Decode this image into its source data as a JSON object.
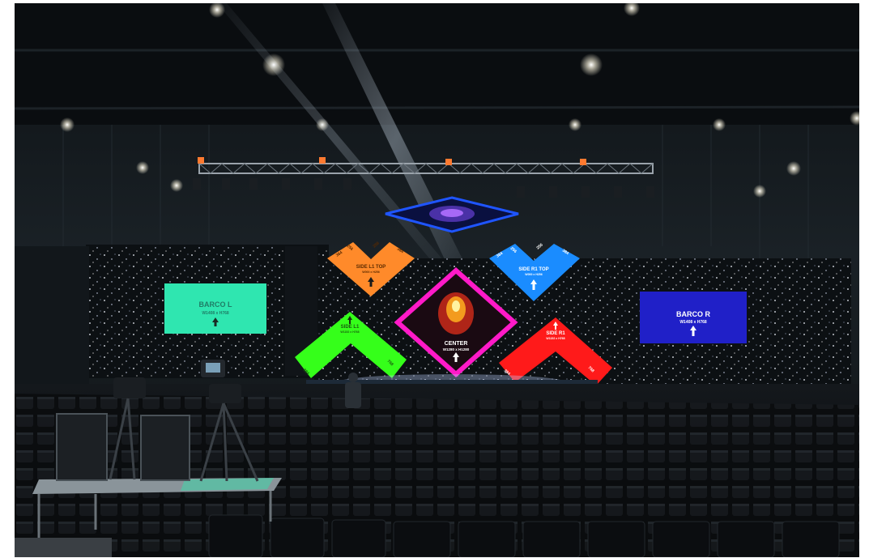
{
  "screens": {
    "barco_left": {
      "title": "BARCO L",
      "size": "W1408 x H768",
      "color": "#2fe6b0"
    },
    "barco_right": {
      "title": "BARCO R",
      "size": "W1408 x H768",
      "color": "#2020c8"
    },
    "side_l1_top": {
      "title": "SIDE L1 TOP",
      "size": "W000 x H256",
      "color": "#ff8a2a",
      "px_a": "384",
      "px_b": "256",
      "px_c": "256",
      "px_d": "384"
    },
    "side_r1_top": {
      "title": "SIDE R1 TOP",
      "size": "W000 x H256",
      "color": "#1a8cff",
      "px_a": "384",
      "px_b": "256",
      "px_c": "256",
      "px_d": "384"
    },
    "side_l1": {
      "title": "SIDE L1",
      "size": "W1152 x H768",
      "color": "#35ff1a",
      "px_a": "384",
      "px_b": "768"
    },
    "side_r1": {
      "title": "SIDE R1",
      "size": "W1152 x H768",
      "color": "#ff1a1a",
      "px_a": "384",
      "px_b": "768"
    },
    "center": {
      "title": "CENTER",
      "size": "W1280 x H1280",
      "color": "#ff1ac8"
    }
  }
}
